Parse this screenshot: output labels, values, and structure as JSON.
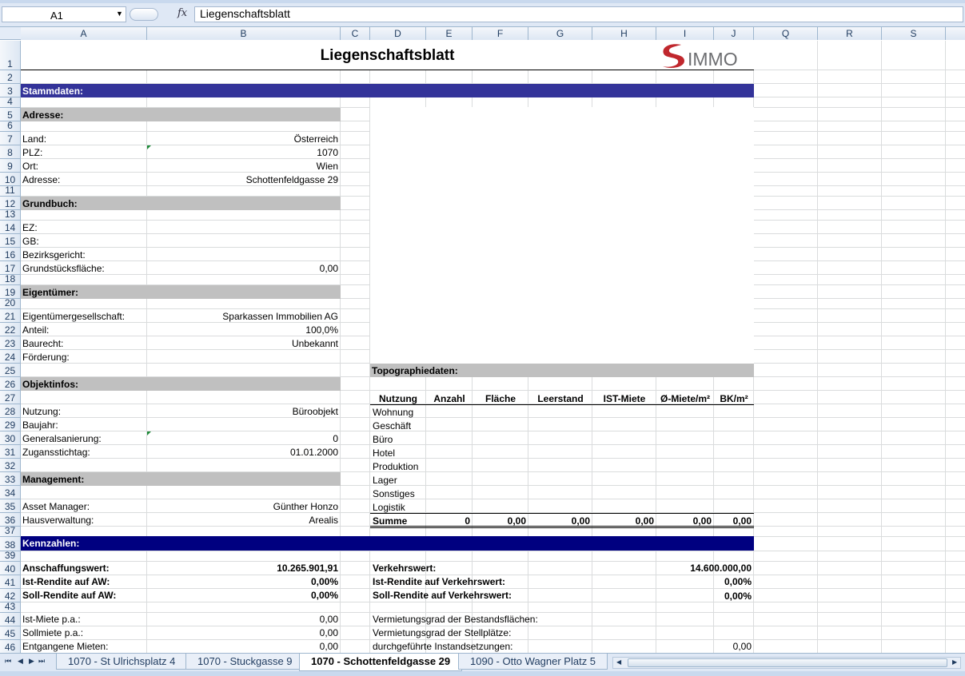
{
  "namebox": "A1",
  "formula_icon": "fx",
  "formula_value": "Liegenschaftsblatt",
  "columns": [
    "A",
    "B",
    "C",
    "D",
    "E",
    "F",
    "G",
    "H",
    "I",
    "J",
    "Q",
    "R",
    "S"
  ],
  "rows": [
    "1",
    "2",
    "3",
    "4",
    "5",
    "6",
    "7",
    "8",
    "9",
    "10",
    "11",
    "12",
    "13",
    "14",
    "15",
    "16",
    "17",
    "18",
    "19",
    "20",
    "21",
    "22",
    "23",
    "24",
    "25",
    "26",
    "27",
    "28",
    "29",
    "30",
    "31",
    "32",
    "33",
    "34",
    "35",
    "36",
    "37",
    "38",
    "39",
    "40",
    "41",
    "42",
    "43",
    "44",
    "45",
    "46"
  ],
  "sheet": {
    "title": "Liegenschaftsblatt",
    "logo_text": "IMMO",
    "stammdaten": "Stammdaten:",
    "adresse_hdr": "Adresse:",
    "land_l": "Land:",
    "land_v": "Österreich",
    "plz_l": "PLZ:",
    "plz_v": "1070",
    "ort_l": "Ort:",
    "ort_v": "Wien",
    "adr_l": "Adresse:",
    "adr_v": "Schottenfeldgasse 29",
    "grundbuch_hdr": "Grundbuch:",
    "ez_l": "EZ:",
    "gb_l": "GB:",
    "bg_l": "Bezirksgericht:",
    "gf_l": "Grundstücksfläche:",
    "gf_v": "0,00",
    "eig_hdr": "Eigentümer:",
    "eg_l": "Eigentümergesellschaft:",
    "eg_v": "Sparkassen Immobilien AG",
    "ant_l": "Anteil:",
    "ant_v": "100,0%",
    "br_l": "Baurecht:",
    "br_v": "Unbekannt",
    "foe_l": "Förderung:",
    "topo_hdr": "Topographiedaten:",
    "obj_hdr": "Objektinfos:",
    "table_headers": [
      "Nutzung",
      "Anzahl",
      "Fläche",
      "Leerstand",
      "IST-Miete",
      "Ø-Miete/m²",
      "BK/m²"
    ],
    "table_rows": [
      "Wohnung",
      "Geschäft",
      "Büro",
      "Hotel",
      "Produktion",
      "Lager",
      "Sonstiges",
      "Logistik"
    ],
    "summe_l": "Summe",
    "summe_vals": [
      "0",
      "0,00",
      "0,00",
      "0,00",
      "0,00",
      "0,00"
    ],
    "nutz_l": "Nutzung:",
    "nutz_v": "Büroobjekt",
    "bj_l": "Baujahr:",
    "gs_l": "Generalsanierung:",
    "gs_v": "0",
    "zs_l": "Zugansstichtag:",
    "zs_v": "01.01.2000",
    "mgmt_hdr": "Management:",
    "am_l": "Asset Manager:",
    "am_v": "Günther Honzo",
    "hv_l": "Hausverwaltung:",
    "hv_v": "Arealis",
    "kenn_hdr": "Kennzahlen:",
    "aw_l": "Anschaffungswert:",
    "aw_v": "10.265.901,91",
    "ir_l": "Ist-Rendite auf AW:",
    "ir_v": "0,00%",
    "sr_l": "Soll-Rendite auf AW:",
    "sr_v": "0,00%",
    "vw_l": "Verkehrswert:",
    "vw_v": "14.600.000,00",
    "irv_l": "Ist-Rendite auf Verkehrswert:",
    "irv_v": "0,00%",
    "srv_l": "Soll-Rendite auf Verkehrswert:",
    "srv_v": "0,00%",
    "im_l": "Ist-Miete p.a.:",
    "im_v": "0,00",
    "sm_l": "Sollmiete p.a.:",
    "sm_v": "0,00",
    "em_l": "Entgangene Mieten:",
    "em_v": "0,00",
    "vb_l": "Vermietungsgrad der Bestandsflächen:",
    "vs_l": "Vermietungsgrad der Stellplätze:",
    "di_l": "durchgeführte Instandsetzungen:",
    "di_v": "0,00"
  },
  "tabs": [
    "1070 - St Ulrichsplatz 4",
    "1070 - Stuckgasse 9",
    "1070 - Schottenfeldgasse 29",
    "1090 - Otto Wagner Platz 5"
  ],
  "colors": {
    "blue_bar": "#333399",
    "navy_bar": "#000080",
    "grey_bar": "#c0c0c0",
    "logo_red": "#c0272d",
    "logo_grey": "#6d6e71"
  }
}
